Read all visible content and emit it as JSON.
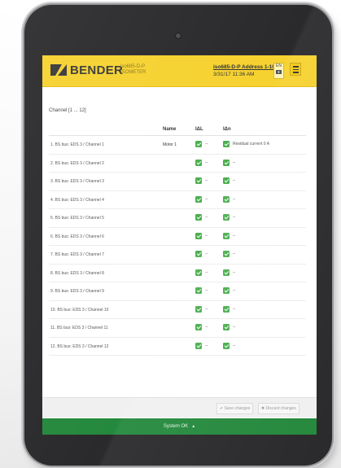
{
  "header": {
    "brand": "BENDER",
    "device_line1": "iso685-D-P",
    "device_line2": "ISOMETER",
    "address": "iso685-D-P Address 1-10",
    "datetime": "3/31/17 11:36 AM",
    "language": "EN"
  },
  "section": {
    "title": "Channel [1 ... 12]"
  },
  "table": {
    "headers": {
      "name": "Name",
      "il": "IΔL",
      "in": "IΔn"
    },
    "rows": [
      {
        "channel": "1. BS bus: EDS 3 / Channel 1",
        "name": "Motor 1",
        "il_val": "--",
        "in_val": "Residual current 0 A"
      },
      {
        "channel": "2. BS bus: EDS 3 / Channel 2",
        "name": "",
        "il_val": "--",
        "in_val": "--"
      },
      {
        "channel": "3. BS bus: EDS 3 / Channel 3",
        "name": "",
        "il_val": "--",
        "in_val": "--"
      },
      {
        "channel": "4. BS bus: EDS 3 / Channel 4",
        "name": "",
        "il_val": "--",
        "in_val": "--"
      },
      {
        "channel": "5. BS bus: EDS 3 / Channel 5",
        "name": "",
        "il_val": "--",
        "in_val": "--"
      },
      {
        "channel": "6. BS bus: EDS 3 / Channel 6",
        "name": "",
        "il_val": "--",
        "in_val": "--"
      },
      {
        "channel": "7. BS bus: EDS 3 / Channel 7",
        "name": "",
        "il_val": "--",
        "in_val": "--"
      },
      {
        "channel": "8. BS bus: EDS 3 / Channel 8",
        "name": "",
        "il_val": "--",
        "in_val": "--"
      },
      {
        "channel": "9. BS bus: EDS 3 / Channel 9",
        "name": "",
        "il_val": "--",
        "in_val": "--"
      },
      {
        "channel": "10. BS bus: EDS 3 / Channel 10",
        "name": "",
        "il_val": "--",
        "in_val": "--"
      },
      {
        "channel": "11. BS bus: EDS 3 / Channel 11",
        "name": "",
        "il_val": "--",
        "in_val": "--"
      },
      {
        "channel": "12. BS bus: EDS 3 / Channel 12",
        "name": "",
        "il_val": "--",
        "in_val": "--"
      }
    ]
  },
  "footer": {
    "save_label": "✔ Save changes",
    "discard_label": "✖ Discard changes",
    "status": "System OK"
  },
  "colors": {
    "header_yellow": "#f6d230",
    "status_green": "#25893d",
    "check_green": "#4caf50"
  }
}
